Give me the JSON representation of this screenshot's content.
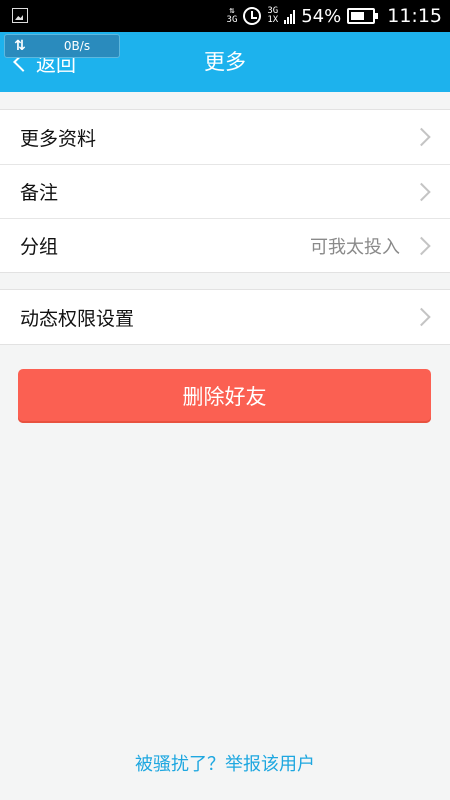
{
  "status_bar": {
    "network_type": "3G",
    "signal_labels": [
      "3G",
      "1X"
    ],
    "battery": "54%",
    "battery_level": 0.54,
    "time": "11:15"
  },
  "net_overlay": {
    "arrows_icon": "up-down-arrows",
    "speed": "0B/s"
  },
  "header": {
    "back_label": "返回",
    "title": "更多"
  },
  "groups": [
    {
      "items": [
        {
          "label": "更多资料",
          "value": ""
        },
        {
          "label": "备注",
          "value": ""
        },
        {
          "label": "分组",
          "value": "可我太投入"
        }
      ]
    },
    {
      "items": [
        {
          "label": "动态权限设置",
          "value": ""
        }
      ]
    }
  ],
  "delete_button": "删除好友",
  "report_link": "被骚扰了？举报该用户",
  "colors": {
    "header": "#1db2ed",
    "delete": "#fb6052",
    "link": "#1ea7e0",
    "background": "#f4f5f5"
  }
}
